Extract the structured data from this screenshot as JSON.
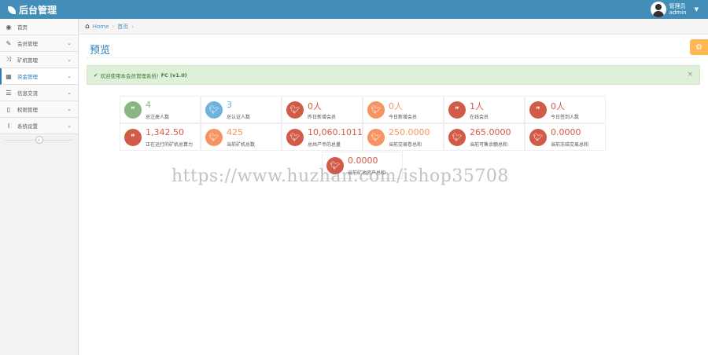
{
  "app": {
    "title": "后台管理"
  },
  "user": {
    "greeting": "管理员",
    "name": "admin"
  },
  "colors": {
    "accent": "#438eb9",
    "green": "#87b87f",
    "blue": "#6fb3e0",
    "red": "#d15b47",
    "orange": "#f79263"
  },
  "sidebar": {
    "items": [
      {
        "label": "首页",
        "icon": "dashboard-icon",
        "glyph": "◉",
        "has_submenu": false,
        "active": false
      },
      {
        "label": "会员管理",
        "icon": "edit-icon",
        "glyph": "✎",
        "has_submenu": true,
        "active": false
      },
      {
        "label": "矿机管理",
        "icon": "random-icon",
        "glyph": "⤨",
        "has_submenu": true,
        "active": false
      },
      {
        "label": "资金管理",
        "icon": "calendar-icon",
        "glyph": "▦",
        "has_submenu": true,
        "active": true
      },
      {
        "label": "信息交流",
        "icon": "list-icon",
        "glyph": "☰",
        "has_submenu": true,
        "active": false
      },
      {
        "label": "权限管理",
        "icon": "file-icon",
        "glyph": "▯",
        "has_submenu": true,
        "active": false
      },
      {
        "label": "系统设置",
        "icon": "text-width-icon",
        "glyph": "I",
        "has_submenu": true,
        "active": false
      }
    ],
    "collapse_glyph": "«"
  },
  "breadcrumbs": {
    "home": "Home",
    "current": "首页",
    "separator": "›"
  },
  "page": {
    "title": "预览"
  },
  "alert": {
    "text": "欢迎使用本会员管理系统!",
    "version": "FC (v1.0)",
    "close": "×"
  },
  "stats": [
    {
      "value": "4",
      "label": "总注册人数",
      "color": "green",
      "icon": "comments-icon"
    },
    {
      "value": "3",
      "label": "总认证人数",
      "color": "blue",
      "icon": "twitter-icon"
    },
    {
      "value": "0人",
      "label": "昨日新增会员",
      "color": "red",
      "icon": "twitter-icon"
    },
    {
      "value": "0人",
      "label": "今日新增会员",
      "color": "orange",
      "icon": "twitter-icon"
    },
    {
      "value": "1人",
      "label": "在线会员",
      "color": "red",
      "icon": "comments-icon"
    },
    {
      "value": "0人",
      "label": "今日签到人数",
      "color": "red",
      "icon": "comments-icon"
    },
    {
      "value": "1,342.50",
      "label": "正在运行的矿机总算力",
      "color": "red",
      "icon": "comments-icon"
    },
    {
      "value": "425",
      "label": "当前矿机总数",
      "color": "orange",
      "icon": "twitter-icon"
    },
    {
      "value": "10,060.1011",
      "label": "总共产币的总量",
      "color": "red",
      "icon": "twitter-icon"
    },
    {
      "value": "250.0000",
      "label": "当前交易卷总和",
      "color": "orange",
      "icon": "twitter-icon"
    },
    {
      "value": "265.0000",
      "label": "当前可售余额总和",
      "color": "red",
      "icon": "twitter-icon"
    },
    {
      "value": "0.0000",
      "label": "当前冻结交易总和",
      "color": "red",
      "icon": "twitter-icon"
    },
    {
      "value": "0.0000",
      "label": "当前矿池资产总和",
      "color": "red",
      "icon": "twitter-icon"
    }
  ],
  "watermark": "https://www.huzhan.com/ishop35708"
}
